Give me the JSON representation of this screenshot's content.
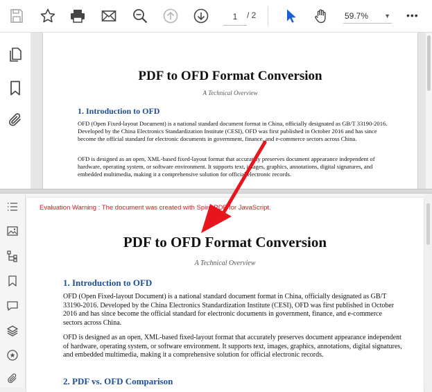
{
  "toolbar": {
    "page_current": "1",
    "page_total": "/ 2",
    "zoom": "59.7%",
    "more": "•••"
  },
  "document": {
    "title": "PDF to OFD Format Conversion",
    "subtitle": "A Technical Overview",
    "section1": "1. Introduction to OFD",
    "para1": "OFD (Open Fixed-layout Document) is a national standard document format in China, officially designated as GB/T 33190-2016. Developed by the China Electronics Standardization Institute (CESI), OFD was first published in October 2016 and has since become the official standard for electronic documents in government, finance, and e-commerce sectors across China.",
    "para2": "OFD is designed as an open, XML-based fixed-layout format that accurately preserves document appearance independent of hardware, operating system, or software environment. It supports text, images, graphics, annotations, digital signatures, and embedded multimedia, making it a comprehensive solution for official electronic records.",
    "section2": "2. PDF vs. OFD Comparison"
  },
  "warning": "Evaluation Warning : The document was created with Spire.PDF for JavaScript.",
  "colors": {
    "heading": "#1f4e96",
    "warning": "#e0141e",
    "arrow": "#e8141e",
    "cursor": "#1a5fd6"
  }
}
